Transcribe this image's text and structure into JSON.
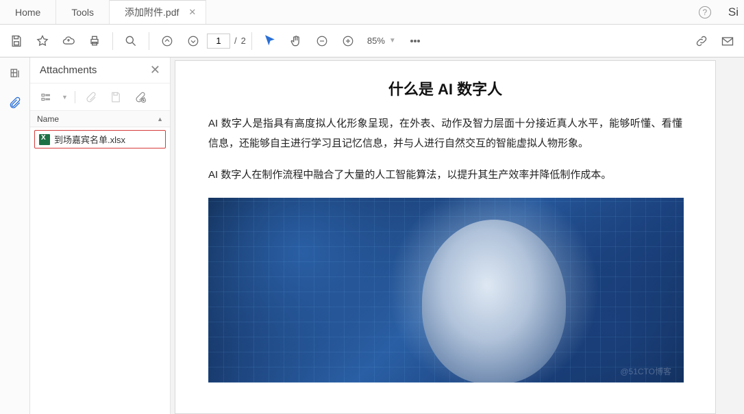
{
  "tabs": {
    "home": "Home",
    "tools": "Tools",
    "document": "添加附件.pdf",
    "signin_fragment": "Si"
  },
  "toolbar": {
    "page_current": "1",
    "page_sep": "/",
    "page_total": "2",
    "zoom": "85%"
  },
  "panel": {
    "title": "Attachments",
    "column_header": "Name",
    "items": [
      {
        "filename": "到场嘉宾名单.xlsx"
      }
    ]
  },
  "document": {
    "title": "什么是 AI 数字人",
    "p1": "AI 数字人是指具有高度拟人化形象呈现，在外表、动作及智力层面十分接近真人水平，能够听懂、看懂信息，还能够自主进行学习且记忆信息，并与人进行自然交互的智能虚拟人物形象。",
    "p2": "AI 数字人在制作流程中融合了大量的人工智能算法，以提升其生产效率并降低制作成本。"
  },
  "watermark": "@51CTO博客"
}
